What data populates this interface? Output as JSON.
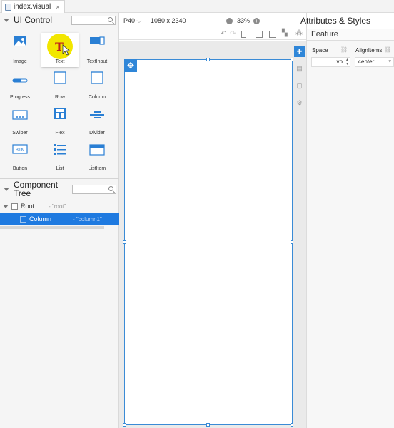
{
  "tab": {
    "title": "index.visual",
    "close": "×"
  },
  "left": {
    "ui_control_title": "UI Control",
    "components": [
      {
        "label": "Image",
        "icon": "image-icon"
      },
      {
        "label": "Text",
        "icon": "text-icon"
      },
      {
        "label": "TextInput",
        "icon": "textinput-icon"
      },
      {
        "label": "Progress",
        "icon": "progress-icon"
      },
      {
        "label": "Row",
        "icon": "row-icon"
      },
      {
        "label": "Column",
        "icon": "column-icon"
      },
      {
        "label": "Swiper",
        "icon": "swiper-icon"
      },
      {
        "label": "Flex",
        "icon": "flex-icon"
      },
      {
        "label": "Divider",
        "icon": "divider-icon"
      },
      {
        "label": "Button",
        "icon": "button-icon"
      },
      {
        "label": "List",
        "icon": "list-icon"
      },
      {
        "label": "ListItem",
        "icon": "listitem-icon"
      }
    ],
    "button_icon_text": "BTN",
    "component_tree_title_1": "Component",
    "component_tree_title_2": "Tree",
    "tree": [
      {
        "name": "Root",
        "id": "- \"root\""
      },
      {
        "name": "Column",
        "id": "- \"column1\""
      }
    ]
  },
  "toolbar": {
    "device": "P40",
    "resolution": "1080 x 2340",
    "zoom": "33%",
    "zoom_out": "−",
    "zoom_in": "+"
  },
  "right": {
    "title": "Attributes & Styles",
    "section": "Feature",
    "space_label": "Space",
    "space_value": "vp",
    "alignitems_label": "AlignItems",
    "alignitems_value": "center"
  },
  "colors": {
    "accent": "#2f86d8",
    "selection": "#1f7ae0",
    "highlight": "#f2e600"
  }
}
